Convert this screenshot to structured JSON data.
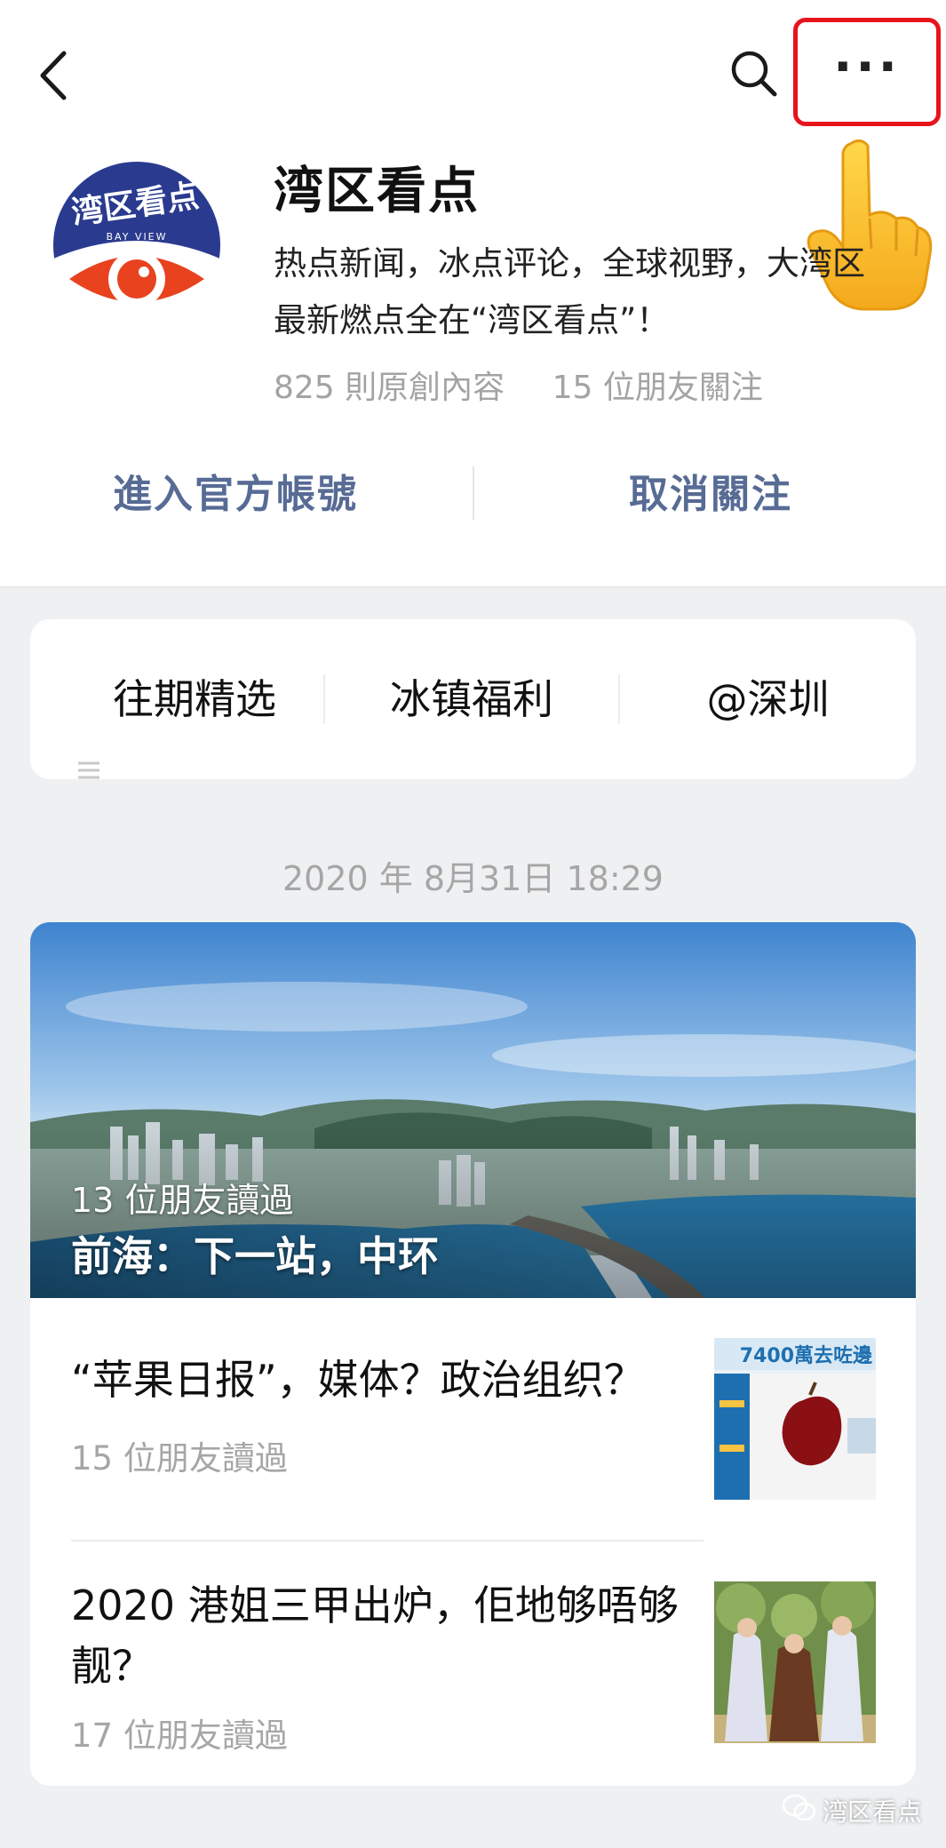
{
  "nav": {
    "back_icon": "back-chevron-icon",
    "search_icon": "search-icon",
    "more_icon": "more-dots-icon",
    "more_label": "···",
    "highlight_color": "#e8141b",
    "hand_icon": "pointing-hand-emoji-icon"
  },
  "account": {
    "logo_text": "湾区看点",
    "logo_subtext": "BAY VIEW",
    "name": "湾区看点",
    "description": "热点新闻，冰点评论，全球视野，大湾区最新燃点全在“湾区看点”！",
    "original_count": "825 則原創內容",
    "friends_following": "15 位朋友關注",
    "brand_color": "#2a3b8f",
    "accent_color": "#e8421f"
  },
  "actions": {
    "enter_label": "進入官方帳號",
    "unfollow_label": "取消關注",
    "link_color": "#576b95"
  },
  "menu": {
    "items": [
      {
        "label": "往期精选"
      },
      {
        "label": "冰镇福利"
      },
      {
        "label": "@深圳"
      }
    ]
  },
  "feed": {
    "timestamp": "2020 年 8月31日 18:29",
    "hero": {
      "readers": "13 位朋友讀過",
      "title": "前海：下一站，中环"
    },
    "articles": [
      {
        "title": "“苹果日报”，媒体？政治组织？",
        "readers": "15 位朋友讀過",
        "thumb_text": "7400萬去咗邊"
      },
      {
        "title": "2020 港姐三甲出炉，佢地够唔够靓？",
        "readers": "17 位朋友讀過"
      }
    ]
  },
  "watermark": {
    "text": "湾区看点",
    "icon": "wechat-icon"
  }
}
